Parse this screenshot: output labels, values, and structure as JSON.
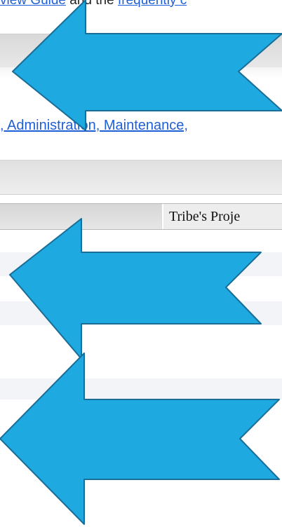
{
  "top_line": {
    "link1": "view Guide",
    "middle": "and the",
    "link2": "frequently c"
  },
  "nav_links": {
    "text": ", Administration, Maintenance,"
  },
  "table": {
    "right_header": "Tribe's Proje"
  },
  "colors": {
    "arrow_fill": "#1ea9e1",
    "arrow_stroke": "#1a6d96",
    "link": "#1f5fd6"
  },
  "icons": [
    "left-arrow-icon",
    "left-arrow-icon",
    "left-arrow-icon"
  ]
}
